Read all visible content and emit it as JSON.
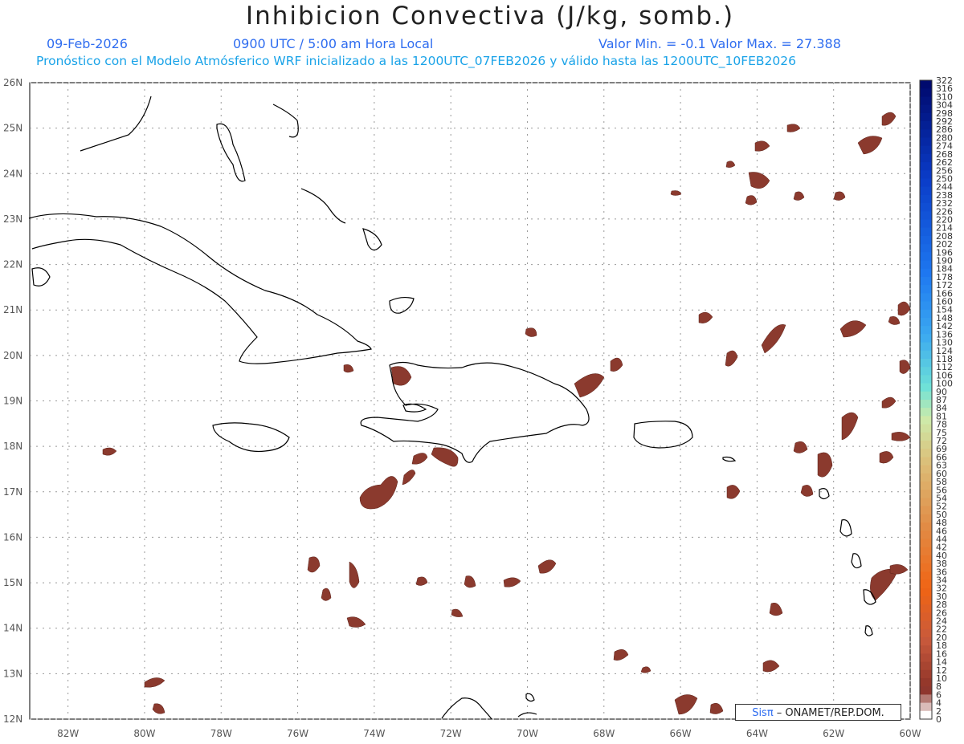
{
  "title": "Inhibicion Convectiva (J/kg, somb.)",
  "date": "09-Feb-2026",
  "time": "0900 UTC / 5:00 am Hora Local",
  "minmax": "Valor Min. = -0.1  Valor Max. = 27.388",
  "model_line": "Pronóstico con el Modelo Atmósferico WRF inicializado a las 1200UTC_07FEB2026 y válido hasta las  1200UTC_10FEB2026",
  "credit": {
    "logo": "Sisπ",
    "text": " – ONAMET/REP.DOM."
  },
  "map": {
    "lon_range": [
      -83,
      -60
    ],
    "lat_range": [
      12,
      26
    ],
    "lon_ticks": [
      "82W",
      "80W",
      "78W",
      "76W",
      "74W",
      "72W",
      "70W",
      "68W",
      "66W",
      "64W",
      "62W",
      "60W"
    ],
    "lat_ticks": [
      "12N",
      "13N",
      "14N",
      "15N",
      "16N",
      "17N",
      "18N",
      "19N",
      "20N",
      "21N",
      "22N",
      "23N",
      "24N",
      "25N",
      "26N"
    ],
    "shade_color": "#8b3a2e",
    "coast_color": "#000000"
  },
  "colorbar": {
    "labels": [
      "322",
      "316",
      "310",
      "304",
      "298",
      "292",
      "286",
      "280",
      "274",
      "268",
      "262",
      "256",
      "250",
      "244",
      "238",
      "232",
      "226",
      "220",
      "214",
      "208",
      "202",
      "196",
      "190",
      "184",
      "178",
      "172",
      "166",
      "160",
      "154",
      "148",
      "142",
      "136",
      "130",
      "124",
      "118",
      "112",
      "106",
      "100",
      "90",
      "87",
      "84",
      "81",
      "78",
      "75",
      "72",
      "69",
      "66",
      "63",
      "60",
      "58",
      "56",
      "54",
      "52",
      "50",
      "48",
      "46",
      "44",
      "42",
      "40",
      "38",
      "36",
      "34",
      "32",
      "30",
      "28",
      "26",
      "24",
      "22",
      "20",
      "18",
      "16",
      "14",
      "12",
      "10",
      "8",
      "6",
      "4",
      "2",
      "0"
    ]
  }
}
